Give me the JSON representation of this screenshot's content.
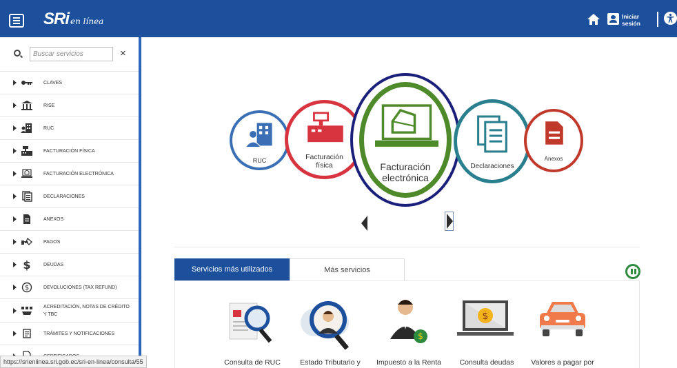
{
  "header": {
    "logo_main": "SRi",
    "logo_sub": "en línea",
    "login_line1": "Iniciar",
    "login_line2": "sesión",
    "home_icon": "home-icon",
    "user_icon": "user-card-icon",
    "accessibility_icon": "accessibility-icon",
    "colors": {
      "bar": "#1c4f9c",
      "text": "#ffffff"
    }
  },
  "sidebar": {
    "search_placeholder": "Buscar servicios",
    "close_label": "×",
    "items": [
      {
        "label": "CLAVES",
        "icon": "key-icon"
      },
      {
        "label": "RISE",
        "icon": "building-columns-icon"
      },
      {
        "label": "RUC",
        "icon": "building-user-icon"
      },
      {
        "label": "FACTURACIÓN FÍSICA",
        "icon": "cash-register-icon"
      },
      {
        "label": "FACTURACIÓN ELECTRÓNICA",
        "icon": "laptop-invoice-icon"
      },
      {
        "label": "DECLARACIONES",
        "icon": "documents-icon"
      },
      {
        "label": "ANEXOS",
        "icon": "file-icon"
      },
      {
        "label": "PAGOS",
        "icon": "hand-payment-icon"
      },
      {
        "label": "DEUDAS",
        "icon": "dollar-icon"
      },
      {
        "label": "DEVOLUCIONES (TAX REFUND)",
        "icon": "dollar-circle-icon"
      },
      {
        "label": "ACREDITACIÓN, NOTAS DE CRÉDITO Y TBC",
        "icon": "credit-notes-icon"
      },
      {
        "label": "TRÁMITES Y NOTIFICACIONES",
        "icon": "notification-doc-icon"
      },
      {
        "label": "CERTIFICADOS",
        "icon": "certificate-icon"
      }
    ]
  },
  "status_url": "https://srienlinea.sri.gob.ec/sri-en-linea/consulta/55",
  "carousel": {
    "items": [
      {
        "label": "RUC",
        "color": "#3a6fb5"
      },
      {
        "label_line1": "Facturación",
        "label_line2": "física",
        "color": "#d8343f"
      },
      {
        "label_line1": "Facturación",
        "label_line2": "electrónica",
        "color": "#4f8a2a",
        "outer_ring": "#1a1f7a"
      },
      {
        "label": "Declaraciones",
        "color": "#2a7f8f"
      },
      {
        "label": "Anexos",
        "color": "#c0392b"
      }
    ]
  },
  "tabs": {
    "active": "Servicios más utilizados",
    "other": "Más servicios"
  },
  "services": [
    {
      "label": "Consulta de RUC",
      "icon": "search-document-icon"
    },
    {
      "label": "Estado Tributario y",
      "icon": "person-magnifier-icon"
    },
    {
      "label": "Impuesto a la Renta",
      "icon": "person-money-icon"
    },
    {
      "label": "Consulta deudas",
      "icon": "laptop-dollar-icon"
    },
    {
      "label": "Valores a pagar por",
      "icon": "car-icon"
    }
  ]
}
